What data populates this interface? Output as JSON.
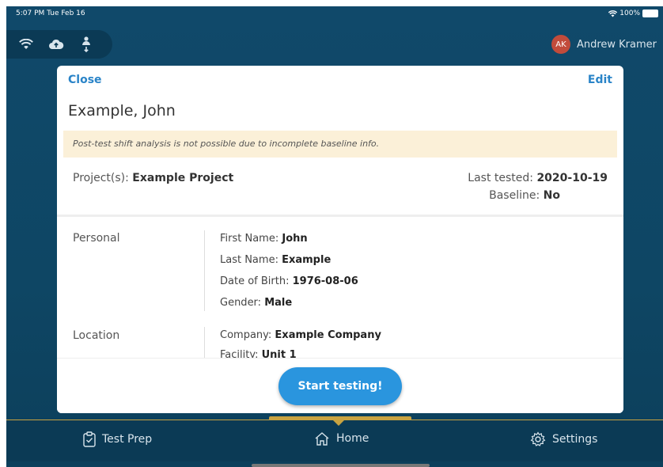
{
  "status_bar": {
    "time_date": "5:07 PM  Tue Feb 16",
    "battery": "100%"
  },
  "icons": [
    "wifi-icon",
    "cloud-upload-icon",
    "person-sync-icon",
    "clipboard-check-icon",
    "home-icon",
    "gear-icon"
  ],
  "user": {
    "initials": "AK",
    "name": "Andrew Kramer",
    "avatar_color": "#c24b3b"
  },
  "modal": {
    "close_label": "Close",
    "edit_label": "Edit",
    "patient_name": "Example, John",
    "warning": "Post-test shift analysis is not possible due to incomplete baseline info.",
    "projects_label": "Project(s):",
    "projects_value": "Example Project",
    "last_tested_label": "Last tested:",
    "last_tested_value": "2020-10-19",
    "baseline_label": "Baseline:",
    "baseline_value": "No",
    "sections": {
      "personal": {
        "label": "Personal",
        "fields": [
          {
            "label": "First Name:",
            "value": "John"
          },
          {
            "label": "Last Name:",
            "value": "Example"
          },
          {
            "label": "Date of Birth:",
            "value": "1976-08-06"
          },
          {
            "label": "Gender:",
            "value": "Male"
          }
        ]
      },
      "location": {
        "label": "Location",
        "fields": [
          {
            "label": "Company:",
            "value": "Example Company"
          },
          {
            "label": "Facility:",
            "value": "Unit 1"
          }
        ]
      }
    },
    "start_button": "Start testing!"
  },
  "tabs": [
    {
      "label": "Test Prep",
      "icon": "clipboard-check-icon"
    },
    {
      "label": "Home",
      "icon": "home-icon",
      "active": true
    },
    {
      "label": "Settings",
      "icon": "gear-icon"
    }
  ],
  "colors": {
    "accent": "#2a95de",
    "link": "#2a84c8",
    "tab_indicator": "#c9a341",
    "background": "#10496a"
  }
}
